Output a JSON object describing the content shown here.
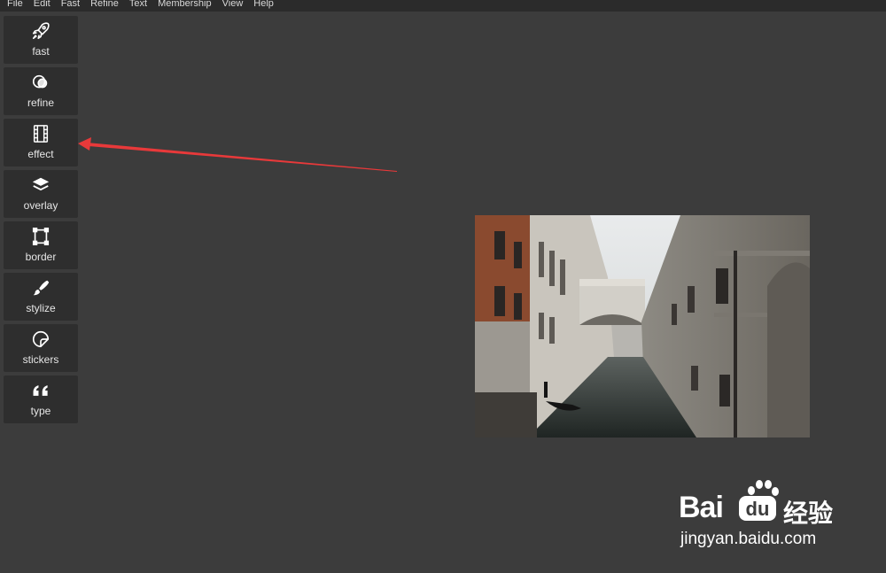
{
  "menu": {
    "items": [
      "File",
      "Edit",
      "Fast",
      "Refine",
      "Text",
      "Membership",
      "View",
      "Help"
    ]
  },
  "tools": [
    {
      "label": "fast",
      "icon": "rocket-icon"
    },
    {
      "label": "refine",
      "icon": "circles-icon"
    },
    {
      "label": "effect",
      "icon": "film-icon"
    },
    {
      "label": "overlay",
      "icon": "layers-icon"
    },
    {
      "label": "border",
      "icon": "frame-icon"
    },
    {
      "label": "stylize",
      "icon": "brush-icon"
    },
    {
      "label": "stickers",
      "icon": "sticker-icon"
    },
    {
      "label": "type",
      "icon": "quote-icon"
    }
  ],
  "photo": {
    "subject": "Venice canal with Bridge of Sighs"
  },
  "annotation": {
    "arrow_color": "#e8393a"
  },
  "watermark": {
    "brand": "Bai",
    "brand_cn": "经验",
    "url": "jingyan.baidu.com"
  },
  "colors": {
    "background": "#3c3c3c",
    "menubar": "#2b2b2b",
    "tool_button": "#2e2e2e"
  }
}
